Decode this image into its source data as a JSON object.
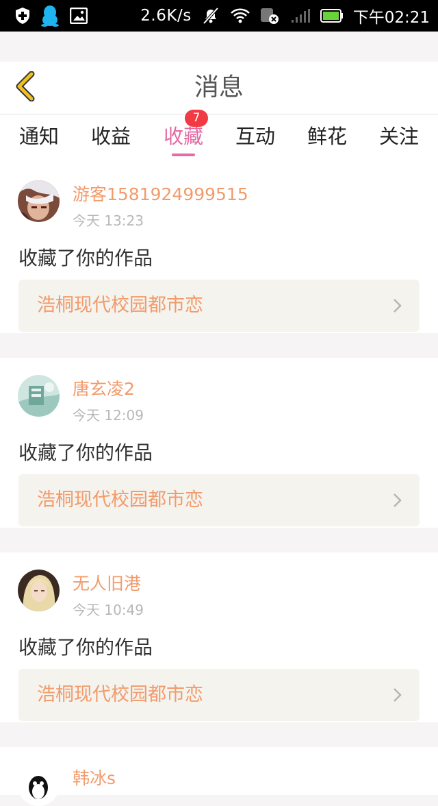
{
  "status_bar": {
    "speed": "2.6K/s",
    "time": "下午02:21",
    "icons": [
      "shield-plus-icon",
      "qq-penguin-icon",
      "image-icon",
      "mute-icon",
      "wifi-icon",
      "data-off-icon",
      "signal-icon",
      "battery-icon"
    ]
  },
  "header": {
    "title": "消息",
    "back_icon": "chevron-left-icon"
  },
  "tabs": [
    {
      "label": "通知",
      "active": false
    },
    {
      "label": "收益",
      "active": false
    },
    {
      "label": "收藏",
      "active": true,
      "badge": "7"
    },
    {
      "label": "互动",
      "active": false
    },
    {
      "label": "鲜花",
      "active": false
    },
    {
      "label": "关注",
      "active": false
    }
  ],
  "messages": [
    {
      "username": "游客1581924999515",
      "time": "今天 13:23",
      "action": "收藏了你的作品",
      "work_title": "浩桐现代校园都市恋"
    },
    {
      "username": "唐玄凌2",
      "time": "今天 12:09",
      "action": "收藏了你的作品",
      "work_title": "浩桐现代校园都市恋"
    },
    {
      "username": "无人旧港",
      "time": "今天 10:49",
      "action": "收藏了你的作品",
      "work_title": "浩桐现代校园都市恋"
    },
    {
      "username": "韩冰s"
    }
  ],
  "colors": {
    "accent_pink": "#e66aa4",
    "username_orange": "#f29b6b",
    "badge_red": "#f23a45",
    "back_arrow_yellow": "#f2c21b"
  }
}
